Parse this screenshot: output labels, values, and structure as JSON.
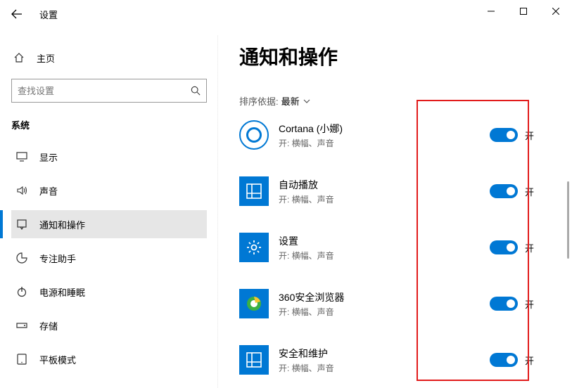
{
  "window": {
    "title": "设置"
  },
  "sidebar": {
    "home": "主页",
    "searchPlaceholder": "查找设置",
    "groupHeader": "系统",
    "items": [
      {
        "label": "显示",
        "icon": "display"
      },
      {
        "label": "声音",
        "icon": "sound"
      },
      {
        "label": "通知和操作",
        "icon": "notifications",
        "selected": true
      },
      {
        "label": "专注助手",
        "icon": "focus"
      },
      {
        "label": "电源和睡眠",
        "icon": "power"
      },
      {
        "label": "存储",
        "icon": "storage"
      },
      {
        "label": "平板模式",
        "icon": "tablet"
      }
    ]
  },
  "content": {
    "pageTitle": "通知和操作",
    "sortLabel": "排序依据:",
    "sortValue": "最新",
    "apps": [
      {
        "name": "Cortana (小娜)",
        "sub": "开: 横幅、声音",
        "icon": "cortana",
        "toggleLabel": "开"
      },
      {
        "name": "自动播放",
        "sub": "开: 横幅、声音",
        "icon": "autoplay",
        "toggleLabel": "开"
      },
      {
        "name": "设置",
        "sub": "开: 横幅、声音",
        "icon": "settings",
        "toggleLabel": "开"
      },
      {
        "name": "360安全浏览器",
        "sub": "开: 横幅、声音",
        "icon": "browser360",
        "toggleLabel": "开"
      },
      {
        "name": "安全和维护",
        "sub": "开: 横幅、声音",
        "icon": "security",
        "toggleLabel": "开"
      }
    ]
  }
}
